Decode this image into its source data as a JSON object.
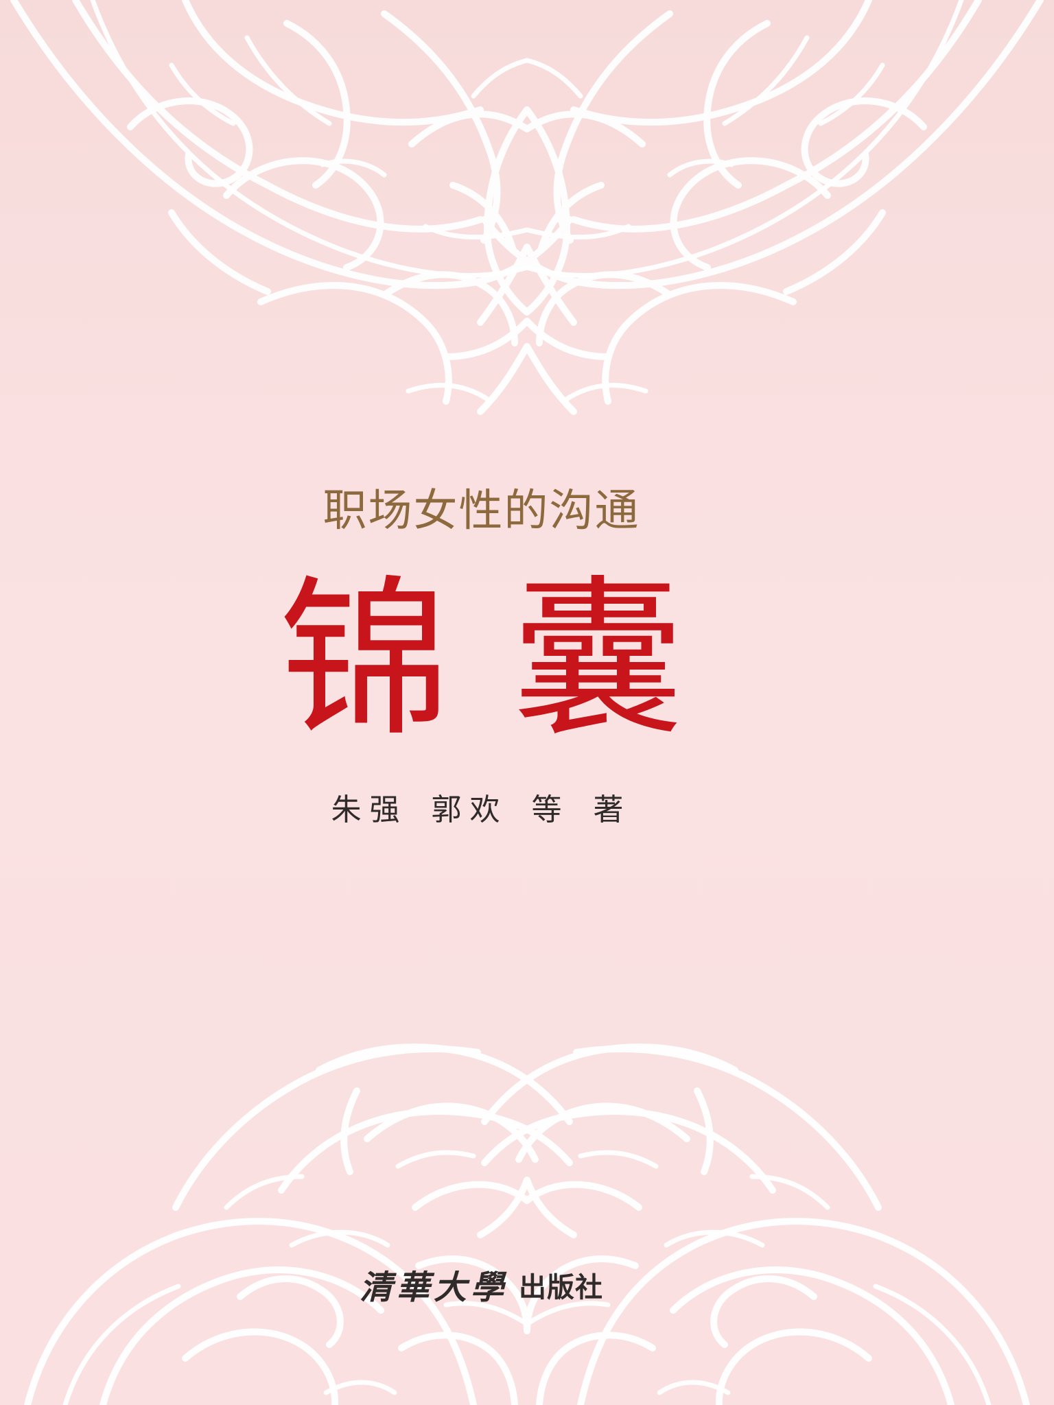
{
  "book": {
    "subtitle": "职场女性的沟通",
    "title": {
      "char1": "锦",
      "char2": "囊"
    },
    "authors": {
      "names1": "朱强",
      "names2": "郭欢",
      "names3": "等",
      "role": "著"
    },
    "publisher": {
      "logo_text": "清華大學",
      "suffix": "出版社"
    }
  },
  "colors": {
    "background": "#f9dfdf",
    "ornament": "#ffffff",
    "subtitle": "#8c6a3e",
    "title": "#c8141b",
    "author": "#2f2b2b"
  },
  "icons": {
    "top_ornament": "lotus-scroll-ornament",
    "bottom_ornament": "arabesque-scroll-ornament"
  }
}
